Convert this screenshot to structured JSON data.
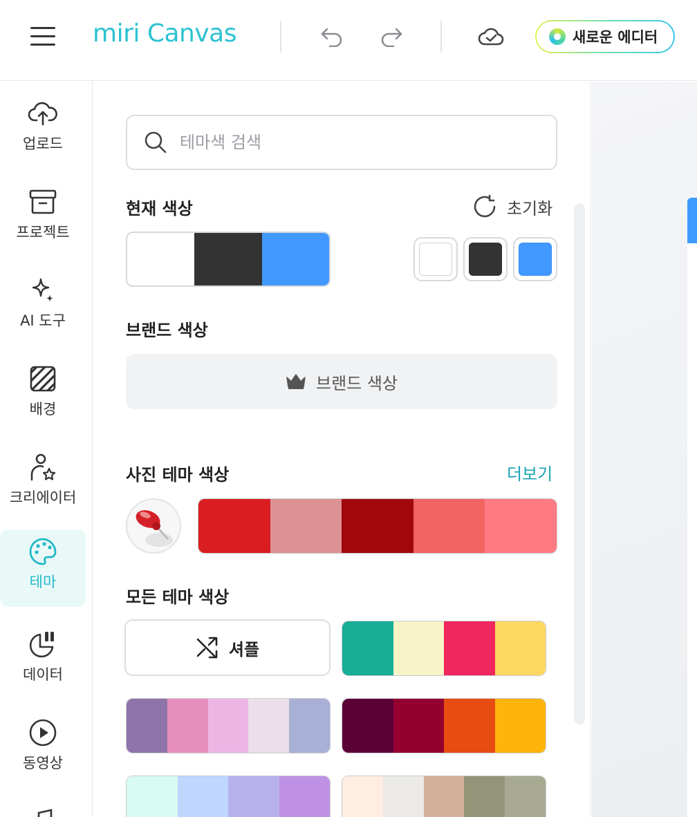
{
  "header": {
    "logo": "miri Canvas",
    "new_editor_label": "새로운 에디터"
  },
  "sidebar": {
    "items": [
      {
        "label": "업로드",
        "icon": "cloud-upload-icon"
      },
      {
        "label": "프로젝트",
        "icon": "archive-box-icon"
      },
      {
        "label": "AI 도구",
        "icon": "sparkle-icon"
      },
      {
        "label": "배경",
        "icon": "pattern-background-icon"
      },
      {
        "label": "크리에이터",
        "icon": "creator-star-icon"
      },
      {
        "label": "테마",
        "icon": "palette-icon",
        "active": true
      },
      {
        "label": "데이터",
        "icon": "chart-pie-icon"
      },
      {
        "label": "동영상",
        "icon": "play-circle-icon"
      }
    ]
  },
  "panel": {
    "search_placeholder": "테마색 검색",
    "current_colors": {
      "title": "현재 색상",
      "reset_label": "초기화",
      "colors": [
        "#FFFFFF",
        "#333333",
        "#4199FF"
      ]
    },
    "brand_colors": {
      "title": "브랜드 색상",
      "button_label": "브랜드 색상"
    },
    "photo_theme": {
      "title": "사진 테마 색상",
      "more_label": "더보기",
      "colors": [
        "#D91E22",
        "#DC9193",
        "#A0080B",
        "#F26462",
        "#FF7B84"
      ]
    },
    "all_themes": {
      "title": "모든 테마 색상",
      "shuffle_label": "셔플",
      "palettes": [
        [
          "#17AD97",
          "#F9F3C8",
          "#F0265E",
          "#FFD763"
        ],
        [
          "#8E74A8",
          "#E78FBC",
          "#EDB5E4",
          "#ECDFE9",
          "#A9B0D5"
        ],
        [
          "#5C0038",
          "#940130",
          "#E74C10",
          "#FFB40A"
        ],
        [
          "#D8FBF4",
          "#BFD6FF",
          "#B7B1EB",
          "#BF91E4"
        ],
        [
          "#FFEDE1",
          "#EBEAE6",
          "#D2B09A",
          "#949578",
          "#A7A991"
        ]
      ]
    }
  }
}
